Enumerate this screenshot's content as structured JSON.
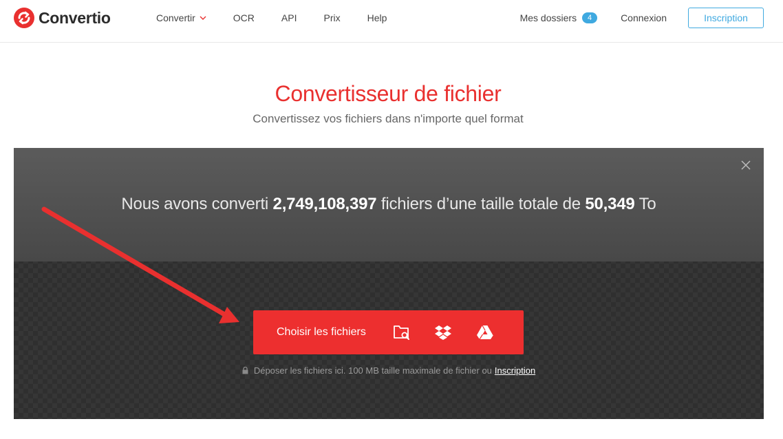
{
  "brand": {
    "name": "Convertio",
    "color": "#e9302f"
  },
  "nav": {
    "items": [
      {
        "label": "Convertir",
        "has_dropdown": true
      },
      {
        "label": "OCR"
      },
      {
        "label": "API"
      },
      {
        "label": "Prix"
      },
      {
        "label": "Help"
      }
    ]
  },
  "account": {
    "folders_label": "Mes dossiers",
    "folders_count": "4",
    "login_label": "Connexion",
    "signup_label": "Inscription"
  },
  "hero": {
    "title": "Convertisseur de fichier",
    "subtitle": "Convertissez vos fichiers dans n'importe quel format"
  },
  "stats": {
    "prefix": "Nous avons converti ",
    "files_count": "2,749,108,397",
    "middle": " fichiers d’une taille totale de ",
    "total_size": "50,349",
    "suffix": " To"
  },
  "upload": {
    "choose_label": "Choisir les fichiers",
    "sources": [
      "folder-search-icon",
      "dropbox-icon",
      "google-drive-icon"
    ],
    "drop_note": "Déposer les fichiers ici. 100 MB taille maximale de fichier ou",
    "drop_link": "Inscription"
  },
  "colors": {
    "accent": "#ed2f2f",
    "link": "#3fa9e0",
    "panel": "#2f2f2f"
  }
}
